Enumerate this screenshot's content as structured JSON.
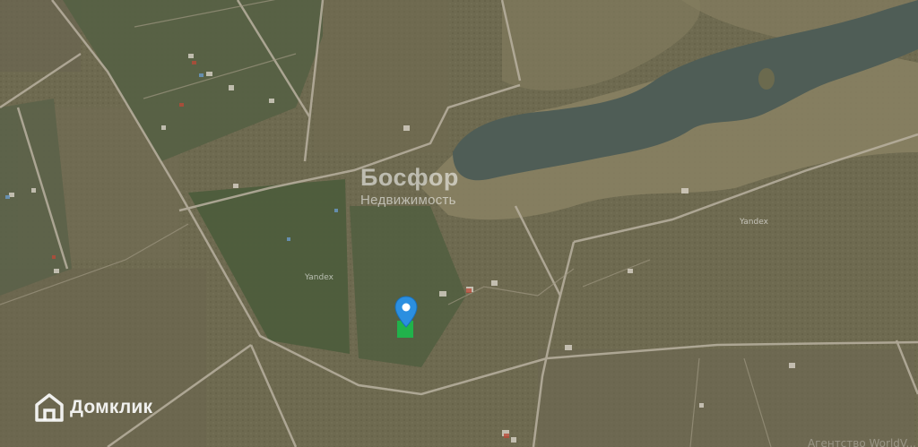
{
  "map": {
    "watermark_title": "Босфор",
    "watermark_subtitle": "Недвижимость",
    "yandex_label_1": "Yandex",
    "yandex_label_2": "Yandex",
    "marker": "location-pin-icon",
    "plot_color": "#21b24b",
    "pin_color": "#2b8fe0",
    "water_color": "#4f5d56"
  },
  "brand": {
    "name": "Домклик",
    "logo": "domklik-house-logo"
  },
  "attribution": "Агентство WorldV..."
}
